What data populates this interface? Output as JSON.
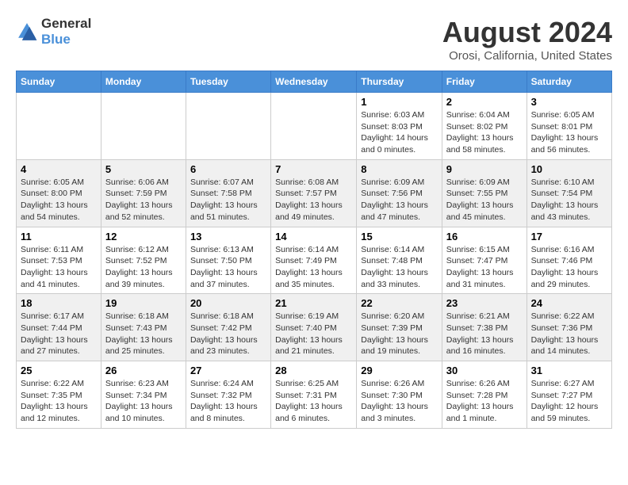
{
  "header": {
    "logo_line1": "General",
    "logo_line2": "Blue",
    "main_title": "August 2024",
    "subtitle": "Orosi, California, United States"
  },
  "weekdays": [
    "Sunday",
    "Monday",
    "Tuesday",
    "Wednesday",
    "Thursday",
    "Friday",
    "Saturday"
  ],
  "weeks": [
    [
      {
        "day": "",
        "info": ""
      },
      {
        "day": "",
        "info": ""
      },
      {
        "day": "",
        "info": ""
      },
      {
        "day": "",
        "info": ""
      },
      {
        "day": "1",
        "info": "Sunrise: 6:03 AM\nSunset: 8:03 PM\nDaylight: 14 hours\nand 0 minutes."
      },
      {
        "day": "2",
        "info": "Sunrise: 6:04 AM\nSunset: 8:02 PM\nDaylight: 13 hours\nand 58 minutes."
      },
      {
        "day": "3",
        "info": "Sunrise: 6:05 AM\nSunset: 8:01 PM\nDaylight: 13 hours\nand 56 minutes."
      }
    ],
    [
      {
        "day": "4",
        "info": "Sunrise: 6:05 AM\nSunset: 8:00 PM\nDaylight: 13 hours\nand 54 minutes."
      },
      {
        "day": "5",
        "info": "Sunrise: 6:06 AM\nSunset: 7:59 PM\nDaylight: 13 hours\nand 52 minutes."
      },
      {
        "day": "6",
        "info": "Sunrise: 6:07 AM\nSunset: 7:58 PM\nDaylight: 13 hours\nand 51 minutes."
      },
      {
        "day": "7",
        "info": "Sunrise: 6:08 AM\nSunset: 7:57 PM\nDaylight: 13 hours\nand 49 minutes."
      },
      {
        "day": "8",
        "info": "Sunrise: 6:09 AM\nSunset: 7:56 PM\nDaylight: 13 hours\nand 47 minutes."
      },
      {
        "day": "9",
        "info": "Sunrise: 6:09 AM\nSunset: 7:55 PM\nDaylight: 13 hours\nand 45 minutes."
      },
      {
        "day": "10",
        "info": "Sunrise: 6:10 AM\nSunset: 7:54 PM\nDaylight: 13 hours\nand 43 minutes."
      }
    ],
    [
      {
        "day": "11",
        "info": "Sunrise: 6:11 AM\nSunset: 7:53 PM\nDaylight: 13 hours\nand 41 minutes."
      },
      {
        "day": "12",
        "info": "Sunrise: 6:12 AM\nSunset: 7:52 PM\nDaylight: 13 hours\nand 39 minutes."
      },
      {
        "day": "13",
        "info": "Sunrise: 6:13 AM\nSunset: 7:50 PM\nDaylight: 13 hours\nand 37 minutes."
      },
      {
        "day": "14",
        "info": "Sunrise: 6:14 AM\nSunset: 7:49 PM\nDaylight: 13 hours\nand 35 minutes."
      },
      {
        "day": "15",
        "info": "Sunrise: 6:14 AM\nSunset: 7:48 PM\nDaylight: 13 hours\nand 33 minutes."
      },
      {
        "day": "16",
        "info": "Sunrise: 6:15 AM\nSunset: 7:47 PM\nDaylight: 13 hours\nand 31 minutes."
      },
      {
        "day": "17",
        "info": "Sunrise: 6:16 AM\nSunset: 7:46 PM\nDaylight: 13 hours\nand 29 minutes."
      }
    ],
    [
      {
        "day": "18",
        "info": "Sunrise: 6:17 AM\nSunset: 7:44 PM\nDaylight: 13 hours\nand 27 minutes."
      },
      {
        "day": "19",
        "info": "Sunrise: 6:18 AM\nSunset: 7:43 PM\nDaylight: 13 hours\nand 25 minutes."
      },
      {
        "day": "20",
        "info": "Sunrise: 6:18 AM\nSunset: 7:42 PM\nDaylight: 13 hours\nand 23 minutes."
      },
      {
        "day": "21",
        "info": "Sunrise: 6:19 AM\nSunset: 7:40 PM\nDaylight: 13 hours\nand 21 minutes."
      },
      {
        "day": "22",
        "info": "Sunrise: 6:20 AM\nSunset: 7:39 PM\nDaylight: 13 hours\nand 19 minutes."
      },
      {
        "day": "23",
        "info": "Sunrise: 6:21 AM\nSunset: 7:38 PM\nDaylight: 13 hours\nand 16 minutes."
      },
      {
        "day": "24",
        "info": "Sunrise: 6:22 AM\nSunset: 7:36 PM\nDaylight: 13 hours\nand 14 minutes."
      }
    ],
    [
      {
        "day": "25",
        "info": "Sunrise: 6:22 AM\nSunset: 7:35 PM\nDaylight: 13 hours\nand 12 minutes."
      },
      {
        "day": "26",
        "info": "Sunrise: 6:23 AM\nSunset: 7:34 PM\nDaylight: 13 hours\nand 10 minutes."
      },
      {
        "day": "27",
        "info": "Sunrise: 6:24 AM\nSunset: 7:32 PM\nDaylight: 13 hours\nand 8 minutes."
      },
      {
        "day": "28",
        "info": "Sunrise: 6:25 AM\nSunset: 7:31 PM\nDaylight: 13 hours\nand 6 minutes."
      },
      {
        "day": "29",
        "info": "Sunrise: 6:26 AM\nSunset: 7:30 PM\nDaylight: 13 hours\nand 3 minutes."
      },
      {
        "day": "30",
        "info": "Sunrise: 6:26 AM\nSunset: 7:28 PM\nDaylight: 13 hours\nand 1 minute."
      },
      {
        "day": "31",
        "info": "Sunrise: 6:27 AM\nSunset: 7:27 PM\nDaylight: 12 hours\nand 59 minutes."
      }
    ]
  ]
}
